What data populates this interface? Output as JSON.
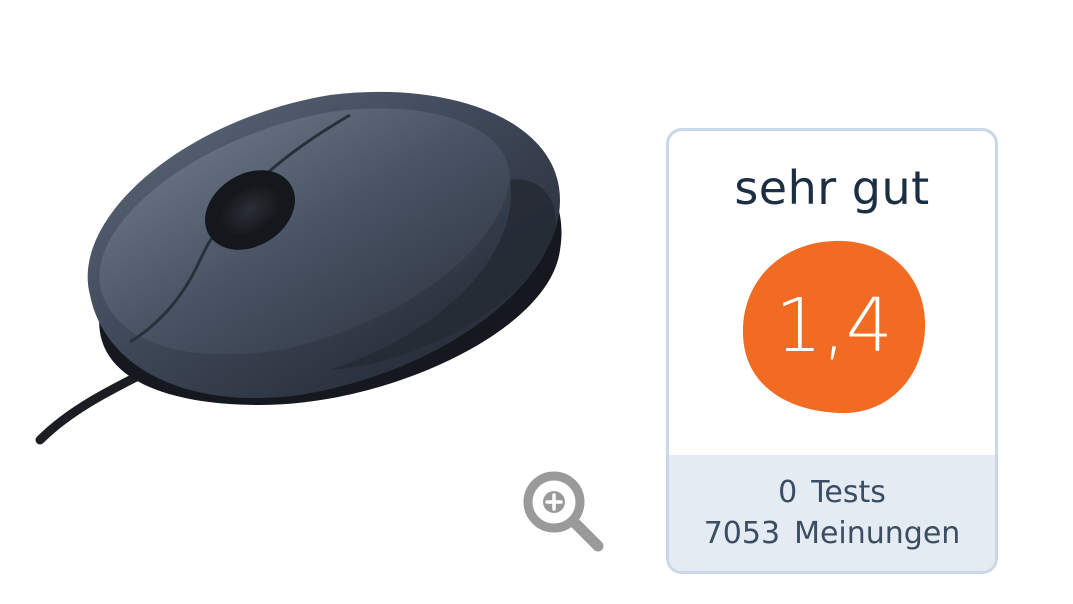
{
  "product": {
    "image_alt": "computer mouse"
  },
  "zoom": {
    "icon": "zoom-in-icon"
  },
  "rating": {
    "label": "sehr gut",
    "grade": "1,4",
    "grade_color": "#f26b23",
    "tests_count": "0",
    "tests_label": "Tests",
    "opinions_count": "7053",
    "opinions_label": "Meinungen"
  }
}
